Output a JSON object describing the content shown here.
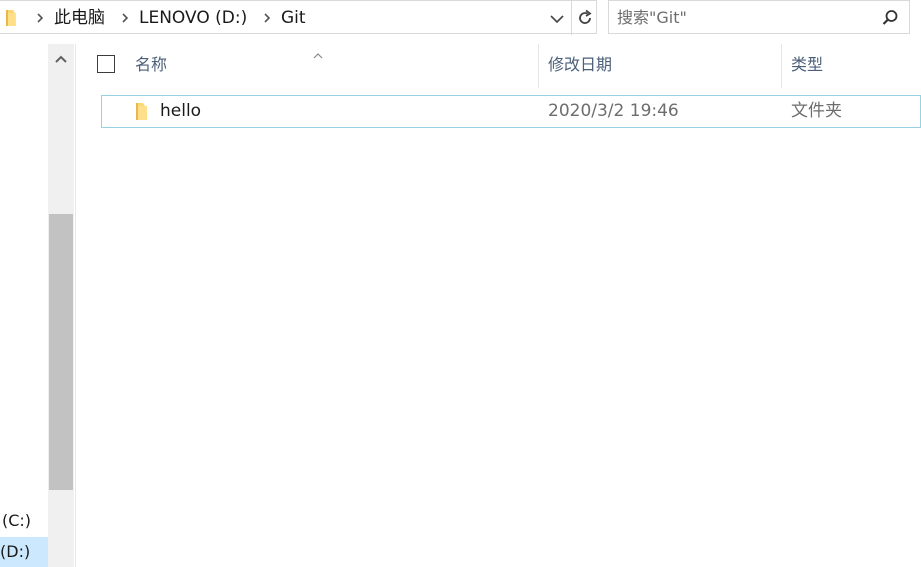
{
  "address_bar": {
    "breadcrumbs": [
      "此电脑",
      "LENOVO (D:)",
      "Git"
    ]
  },
  "search": {
    "placeholder": "搜索\"Git\""
  },
  "nav": {
    "drives": [
      "(C:)",
      "(D:)"
    ]
  },
  "columns": {
    "name": "名称",
    "date": "修改日期",
    "type": "类型"
  },
  "files": [
    {
      "name": "hello",
      "date": "2020/3/2 19:46",
      "type": "文件夹"
    }
  ],
  "colors": {
    "selection": "#cce8ff",
    "row_border": "#99d1e6",
    "header_text": "#4c607a",
    "folder": "#f8d775"
  },
  "icons": {
    "folder": "folder-icon",
    "search": "search-icon",
    "refresh": "refresh-icon",
    "chevron": "chevron-right-icon"
  }
}
